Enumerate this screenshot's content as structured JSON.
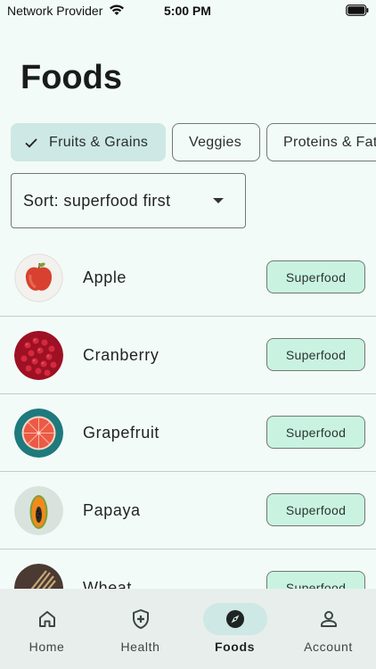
{
  "status_bar": {
    "carrier": "Network Provider",
    "time": "5:00 PM"
  },
  "page": {
    "title": "Foods"
  },
  "filters": [
    {
      "label": "Fruits & Grains",
      "selected": true
    },
    {
      "label": "Veggies",
      "selected": false
    },
    {
      "label": "Proteins & Fats",
      "selected": false
    }
  ],
  "sort": {
    "label": "Sort: superfood first"
  },
  "foods": [
    {
      "name": "Apple",
      "badge": "Superfood",
      "icon": "apple-photo"
    },
    {
      "name": "Cranberry",
      "badge": "Superfood",
      "icon": "cranberry-photo"
    },
    {
      "name": "Grapefruit",
      "badge": "Superfood",
      "icon": "grapefruit-photo"
    },
    {
      "name": "Papaya",
      "badge": "Superfood",
      "icon": "papaya-photo"
    },
    {
      "name": "Wheat",
      "badge": "Superfood",
      "icon": "wheat-photo"
    }
  ],
  "bottom_nav": [
    {
      "label": "Home",
      "icon": "home-icon",
      "active": false
    },
    {
      "label": "Health",
      "icon": "health-shield-icon",
      "active": false
    },
    {
      "label": "Foods",
      "icon": "compass-icon",
      "active": true
    },
    {
      "label": "Account",
      "icon": "person-icon",
      "active": false
    }
  ],
  "colors": {
    "background": "#f3fbf8",
    "chip_selected": "#cde8e5",
    "badge": "#c9f3e0",
    "nav_background": "#e7eeec"
  }
}
